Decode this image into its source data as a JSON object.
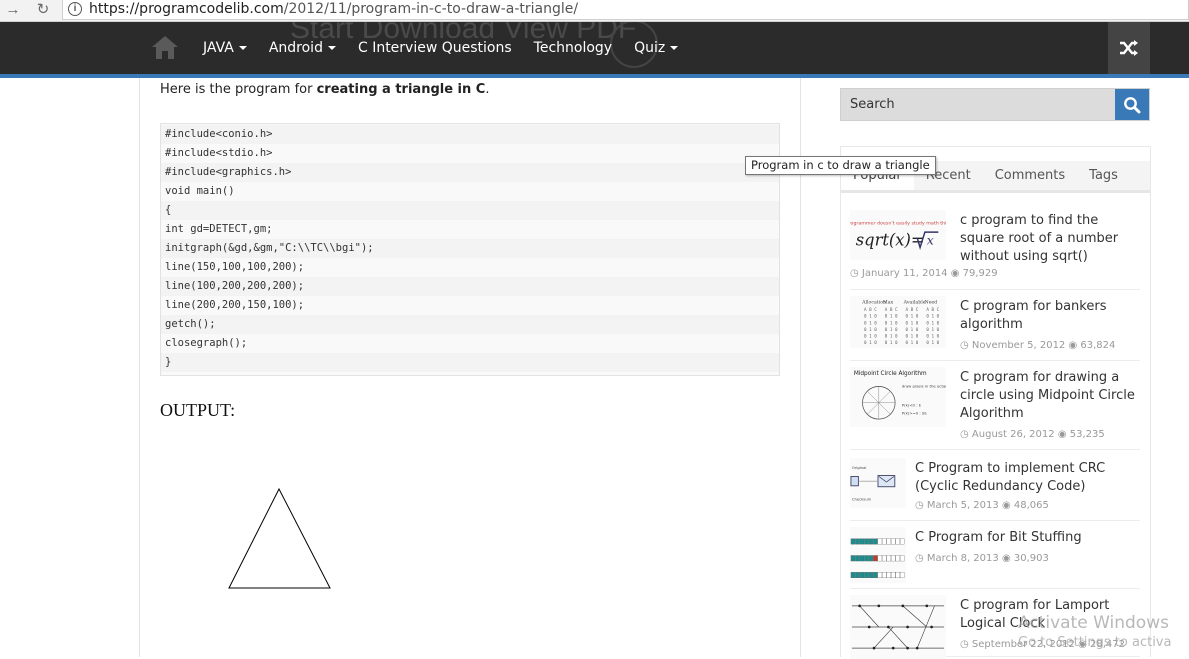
{
  "browser": {
    "url_host": "https://programcodelib.com",
    "url_path": "/2012/11/program-in-c-to-draw-a-triangle/"
  },
  "nav": {
    "ghost_text": "Start Download   View PDF",
    "items": [
      {
        "label": "JAVA",
        "has_dropdown": true
      },
      {
        "label": "Android",
        "has_dropdown": true
      },
      {
        "label": "C Interview Questions",
        "has_dropdown": false
      },
      {
        "label": "Technology",
        "has_dropdown": false
      },
      {
        "label": "Quiz",
        "has_dropdown": true
      }
    ],
    "accent_color": "#3a79b8"
  },
  "article": {
    "intro_prefix": "Here is the program for ",
    "intro_bold": "creating a triangle in C",
    "intro_suffix": ".",
    "code_lines": [
      "#include<conio.h>",
      "#include<stdio.h>",
      "#include<graphics.h>",
      "void main()",
      "{",
      "int gd=DETECT,gm;",
      "initgraph(&gd,&gm,\"C:\\\\TC\\\\bgi\");",
      "line(150,100,100,200);",
      "line(100,200,200,200);",
      "line(200,200,150,100);",
      "getch();",
      "closegraph();",
      "}"
    ],
    "output_heading": "OUTPUT:"
  },
  "sidebar": {
    "search_placeholder": "Search",
    "tooltip": "Program in c to draw a triangle",
    "tabs": [
      {
        "label": "Popular",
        "active": true
      },
      {
        "label": "Recent",
        "active": false
      },
      {
        "label": "Comments",
        "active": false
      },
      {
        "label": "Tags",
        "active": false
      }
    ],
    "posts": [
      {
        "title": "c program to find the square root of a number without using sqrt()",
        "date": "January 11, 2014",
        "views": "79,929",
        "thumb": "sqrt-formula"
      },
      {
        "title": "C program for bankers algorithm",
        "date": "November 5, 2012",
        "views": "63,824",
        "thumb": "bankers-table"
      },
      {
        "title": "C program for drawing a circle using Midpoint Circle Algorithm",
        "date": "August 26, 2012",
        "views": "53,235",
        "thumb": "midpoint-circle",
        "thumb_caption": "Midpoint Circle Algorithm"
      },
      {
        "title": "C Program to implement CRC (Cyclic Redundancy Code)",
        "date": "March 5, 2013",
        "views": "48,065",
        "thumb": "crc-diagram"
      },
      {
        "title": "C Program for Bit Stuffing",
        "date": "March 8, 2013",
        "views": "30,903",
        "thumb": "bit-stuffing"
      },
      {
        "title": "C program for Lamport Logical Clock",
        "date": "September 22, 2012",
        "views": "28,472",
        "thumb": "lamport-clock"
      }
    ]
  },
  "watermark": {
    "line1": "Activate Windows",
    "line2": "Go to Settings to activa"
  }
}
